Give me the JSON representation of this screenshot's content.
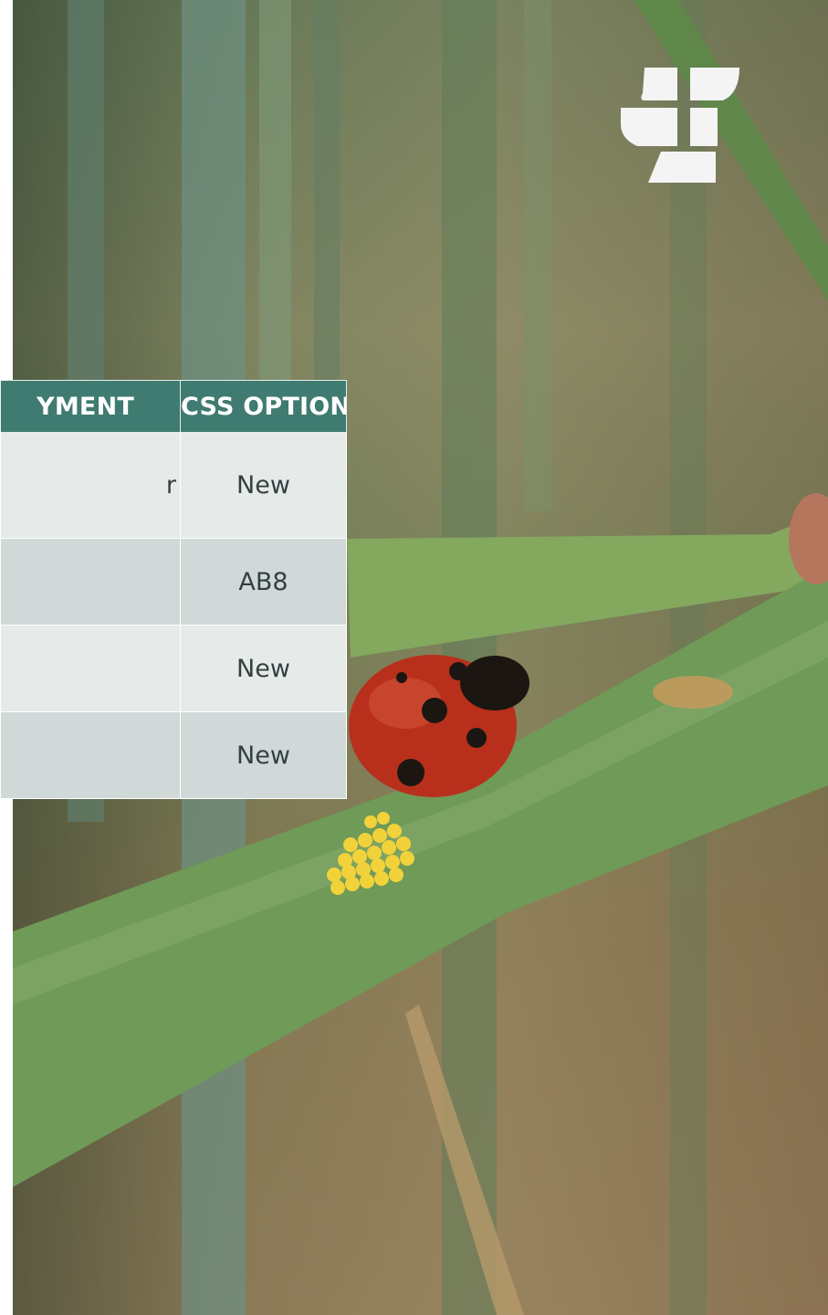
{
  "table": {
    "headers": [
      "YMENT",
      "CSS OPTION"
    ],
    "rows": [
      {
        "c1": "r",
        "c2": "New"
      },
      {
        "c1": "",
        "c2": "AB8"
      },
      {
        "c1": "",
        "c2": "New"
      },
      {
        "c1": "",
        "c2": "New"
      }
    ]
  },
  "colors": {
    "header_bg": "#3f7b70",
    "row_light": "#e6ebea",
    "row_dark": "#d0d9d8",
    "leaf_green": "#6f9a58",
    "logo": "#f4f4f4"
  },
  "icons": {
    "logo": "leaf-logo-icon",
    "photo": "ladybug-on-leaf-photo"
  }
}
